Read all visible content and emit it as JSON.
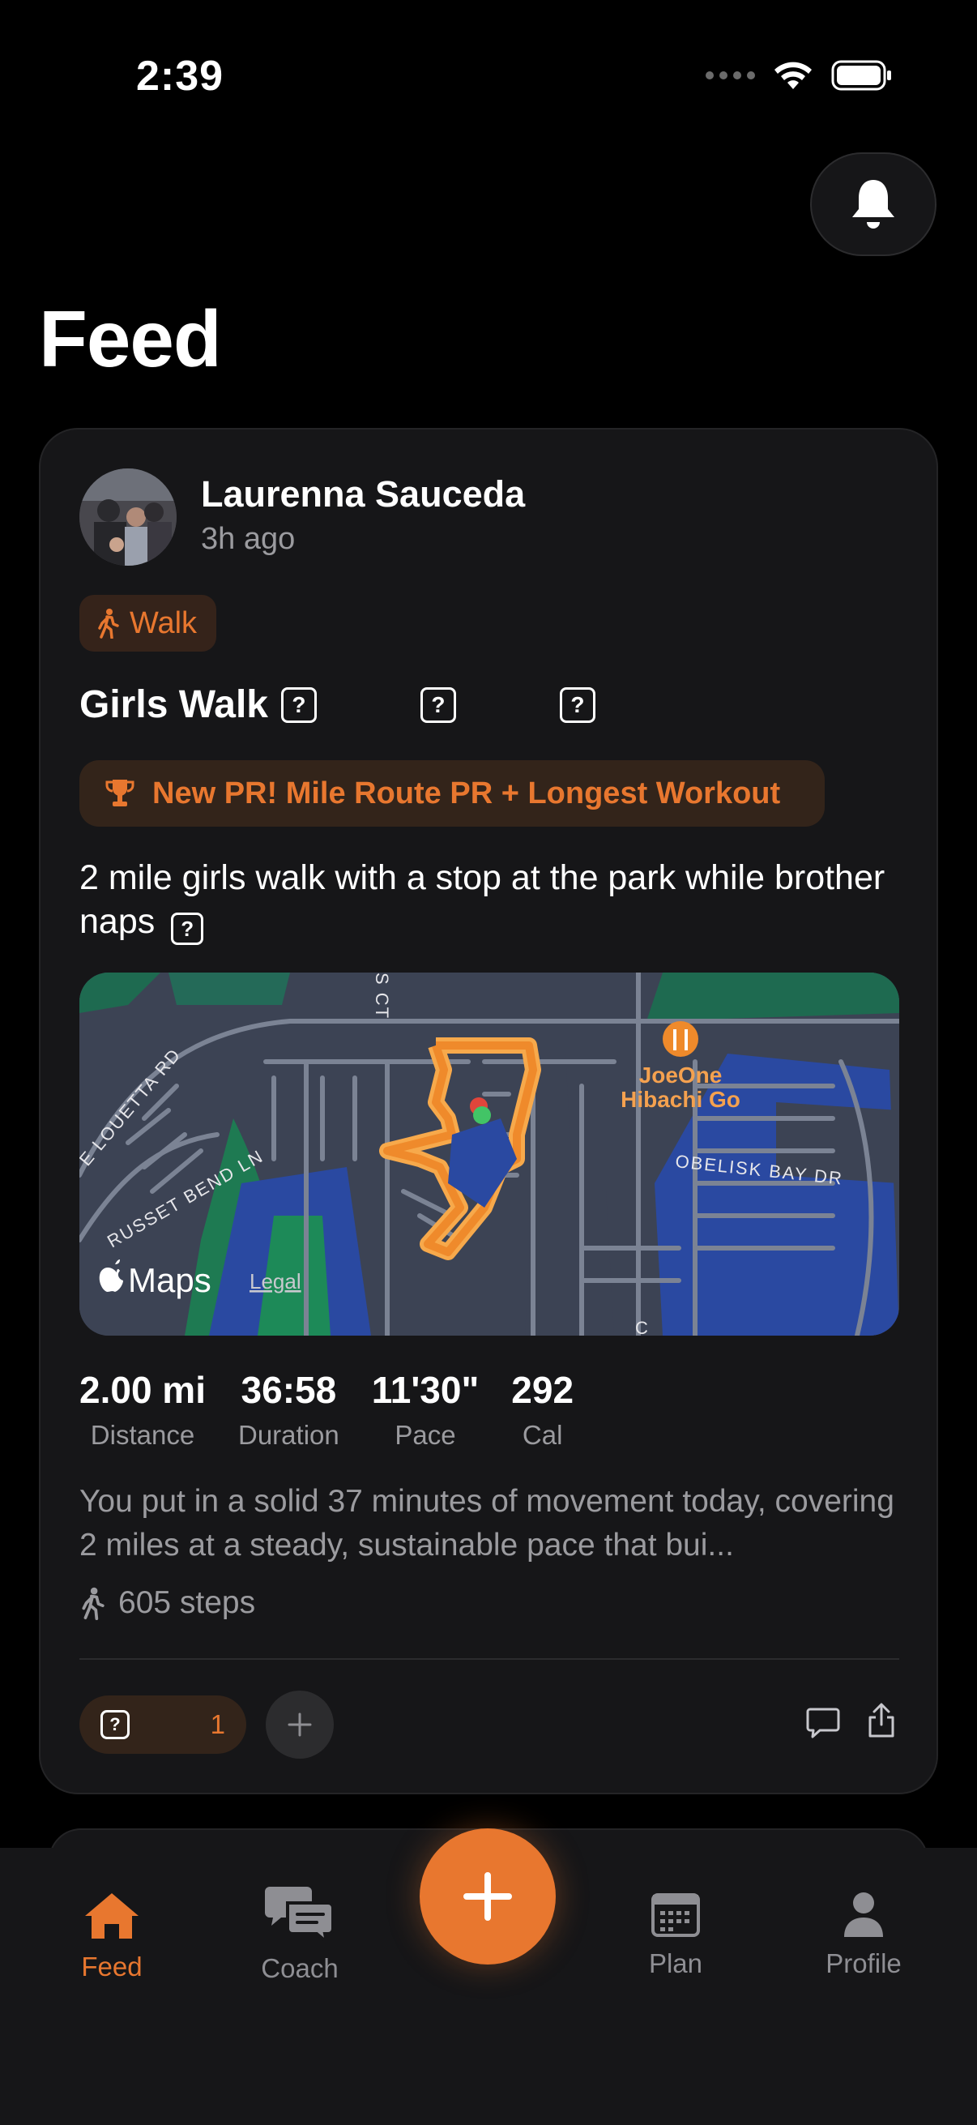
{
  "status_bar": {
    "time": "2:39"
  },
  "header": {
    "title": "Feed"
  },
  "post": {
    "author": "Laurenna Sauceda",
    "time_ago": "3h ago",
    "activity_type": "Walk",
    "title": "Girls Walk",
    "pr_text": "New PR! Mile Route PR + Longest Workout",
    "description": "2 mile girls walk with a stop at the park while brother naps",
    "map": {
      "poi_name_line1": "JoeOne",
      "poi_name_line2": "Hibachi Go",
      "streets": [
        "E LOUETTA RD",
        "RUSSET BEND LN",
        "OBELISK BAY DR",
        "S CT",
        "C"
      ],
      "attribution": "Maps",
      "legal": "Legal"
    },
    "stats": [
      {
        "value": "2.00 mi",
        "label": "Distance"
      },
      {
        "value": "36:58",
        "label": "Duration"
      },
      {
        "value": "11'30\"",
        "label": "Pace"
      },
      {
        "value": "292",
        "label": "Cal"
      }
    ],
    "summary": "You put in a solid 37 minutes of movement today, covering 2 miles at a steady, sustainable pace that bui...",
    "steps": "605 steps",
    "reaction_count": "1"
  },
  "tab_bar": {
    "tabs": [
      {
        "label": "Feed",
        "icon": "home-icon",
        "active": true
      },
      {
        "label": "Coach",
        "icon": "chat-bubbles-icon",
        "active": false
      },
      {
        "label": "Plan",
        "icon": "calendar-icon",
        "active": false
      },
      {
        "label": "Profile",
        "icon": "person-icon",
        "active": false
      }
    ],
    "fab_icon": "plus-icon"
  },
  "colors": {
    "accent": "#e8772f",
    "background": "#000000",
    "card": "#161618",
    "secondary_text": "#9b9b9f"
  }
}
